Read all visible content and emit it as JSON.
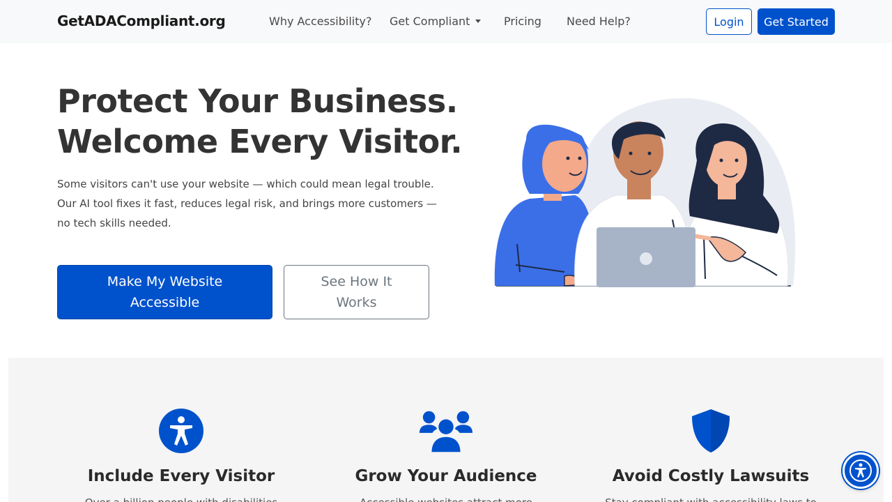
{
  "nav": {
    "brand": "GetADACompliant.org",
    "links": [
      "Why Accessibility?",
      "Get Compliant",
      "Pricing",
      "Need Help?"
    ],
    "login": "Login",
    "get_started": "Get Started"
  },
  "hero": {
    "title_line1": "Protect Your Business.",
    "title_line2": "Welcome Every Visitor.",
    "description": "Some visitors can't use your website — which could mean legal trouble. Our AI tool fixes it fast, reduces legal risk, and brings more customers — no tech skills needed.",
    "primary_cta": "Make My Website Accessible",
    "secondary_cta": "See How It Works"
  },
  "features": [
    {
      "title": "Include Every Visitor",
      "text": "Over a billion people with disabilities",
      "icon": "accessibility-icon"
    },
    {
      "title": "Grow Your Audience",
      "text": "Accessible websites attract more",
      "icon": "users-group-icon"
    },
    {
      "title": "Avoid Costly Lawsuits",
      "text": "Stay compliant with accessibility laws to",
      "icon": "shield-icon"
    }
  ],
  "colors": {
    "primary": "#0052cc",
    "text": "#333333",
    "feature_bg": "#f5f5f5"
  }
}
